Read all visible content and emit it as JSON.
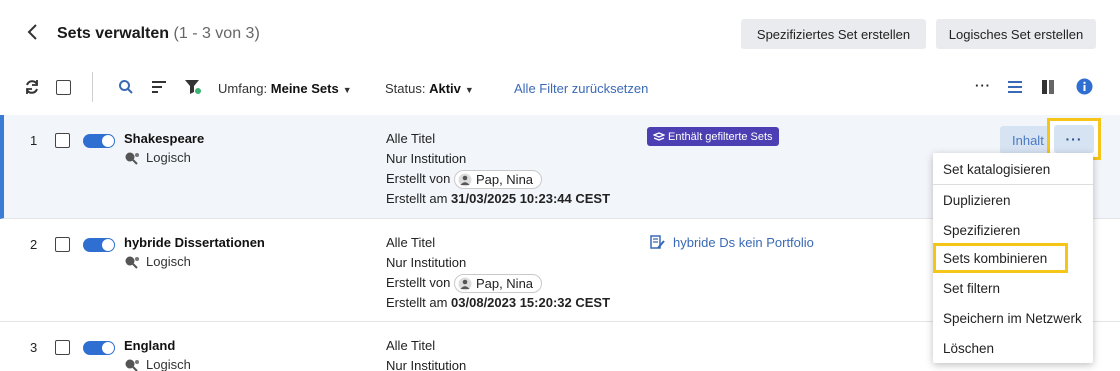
{
  "header": {
    "title": "Sets verwalten",
    "count": "(1 - 3 von 3)",
    "btn_specified": "Spezifiziertes Set erstellen",
    "btn_logical": "Logisches Set erstellen"
  },
  "toolbar": {
    "umfang_label": "Umfang:",
    "umfang_value": "Meine Sets",
    "status_label": "Status:",
    "status_value": "Aktiv",
    "reset_filters": "Alle Filter zurücksetzen"
  },
  "rows": [
    {
      "num": "1",
      "name": "Shakespeare",
      "type": "Logisch",
      "content": "Alle Titel",
      "scope": "Nur Institution",
      "created_by_label": "Erstellt von",
      "created_by": "Pap, Nina",
      "created_on_label": "Erstellt am",
      "created_on": "31/03/2025 10:23:44 CEST",
      "badge": "Enthält gefilterte Sets",
      "action": "Inhalt"
    },
    {
      "num": "2",
      "name": "hybride Dissertationen",
      "type": "Logisch",
      "content": "Alle Titel",
      "scope": "Nur Institution",
      "created_by_label": "Erstellt von",
      "created_by": "Pap, Nina",
      "created_on_label": "Erstellt am",
      "created_on": "03/08/2023 15:20:32 CEST",
      "link": "hybride Ds kein Portfolio"
    },
    {
      "num": "3",
      "name": "England",
      "type": "Logisch",
      "content": "Alle Titel",
      "scope": "Nur Institution"
    }
  ],
  "more_label": "···",
  "menu": {
    "items": [
      "Set katalogisieren",
      "Duplizieren",
      "Spezifizieren",
      "Sets kombinieren",
      "Set filtern",
      "Speichern im Netzwerk",
      "Löschen"
    ]
  },
  "colors": {
    "accent": "#3a7bd5",
    "highlight": "#f5c518",
    "badge": "#4b3fb3"
  }
}
